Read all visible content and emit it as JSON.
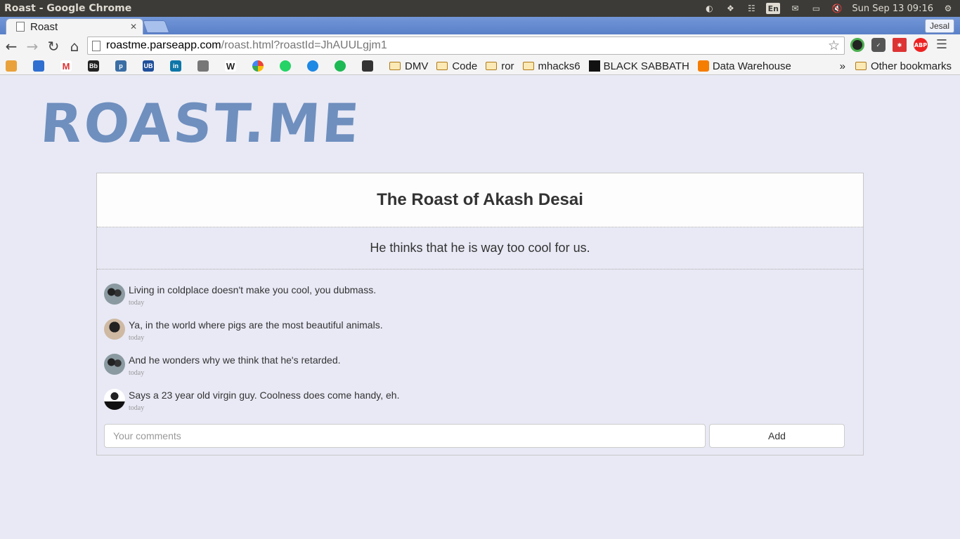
{
  "window": {
    "title": "Roast - Google Chrome",
    "datetime": "Sun Sep 13 09:16",
    "keyboard_layout": "En"
  },
  "tab": {
    "label": "Roast",
    "profile": "Jesal"
  },
  "address": {
    "host": "roastme.parseapp.com",
    "path": "/roast.html?roastId=JhAUULgjm1"
  },
  "bookmarks": {
    "folders": [
      "DMV",
      "Code",
      "ror",
      "mhacks6"
    ],
    "black_sabbath": "BLACK SABBATH",
    "data_warehouse": "Data Warehouse",
    "more": "»",
    "other": "Other bookmarks"
  },
  "page": {
    "logo": "ROAST.ME",
    "roast_title": "The Roast of Akash Desai",
    "roast_description": "He thinks that he is way too cool for us.",
    "comments": [
      {
        "text": "Living in coldplace doesn't make you cool, you dubmass.",
        "time": "today"
      },
      {
        "text": "Ya, in the world where pigs are the most beautiful animals.",
        "time": "today"
      },
      {
        "text": "And he wonders why we think that he's retarded.",
        "time": "today"
      },
      {
        "text": "Says a 23 year old virgin guy. Coolness does come handy, eh.",
        "time": "today"
      }
    ],
    "comment_placeholder": "Your comments",
    "add_label": "Add"
  },
  "colors": {
    "page_bg": "#e8e9f5",
    "logo": "#6f8fbe",
    "tab_strip": "#5a80c8"
  }
}
